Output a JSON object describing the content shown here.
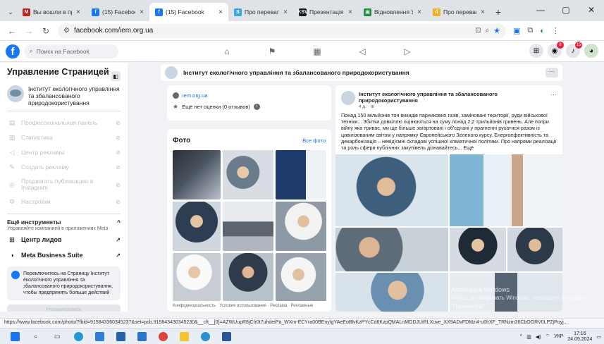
{
  "browser": {
    "tabs": [
      {
        "title": "Вы вошли в про",
        "active": false,
        "fav_color": "#c5221f",
        "fav_glyph": "M"
      },
      {
        "title": "(15) Facebook",
        "active": false,
        "fav_color": "#1877f2",
        "fav_glyph": "f"
      },
      {
        "title": "(15) Facebook",
        "active": true,
        "fav_color": "#1877f2",
        "fav_glyph": "f"
      },
      {
        "title": "Про переваги",
        "active": false,
        "fav_color": "#3aa7e0",
        "fav_glyph": "S"
      },
      {
        "title": "Презентація пр",
        "active": false,
        "fav_color": "#1a1a1a",
        "fav_glyph": "KSV"
      },
      {
        "title": "Відновлення Ук",
        "active": false,
        "fav_color": "#1e8e3e",
        "fav_glyph": "▣"
      },
      {
        "title": "Про переваги",
        "active": false,
        "fav_color": "#f2b01e",
        "fav_glyph": "d"
      }
    ],
    "url": "facebook.com/iem.org.ua",
    "window_controls": [
      "—",
      "▢",
      "✕"
    ]
  },
  "fb_nav": {
    "search_placeholder": "Поиск на Facebook",
    "badge_count": "15",
    "notif_badge": "8"
  },
  "sidebar": {
    "title": "Управление Страницей",
    "page_name": "Інститут екологічного управління та збалансованого природокористування",
    "items": [
      {
        "icon": "panel-icon",
        "glyph": "▤",
        "label": "Профессиональная панель"
      },
      {
        "icon": "stats-icon",
        "glyph": "▥",
        "label": "Статистика"
      },
      {
        "icon": "ads-icon",
        "glyph": "◁",
        "label": "Центр рекламы"
      },
      {
        "icon": "edit-icon",
        "glyph": "✎",
        "label": "Создать рекламу"
      },
      {
        "icon": "instagram-icon",
        "glyph": "◎",
        "label": "Продвигать публикацию в Instagram"
      },
      {
        "icon": "settings-icon",
        "glyph": "⚙",
        "label": "Настройки"
      }
    ],
    "more_tools": "Ещё инструменты",
    "more_tools_sub": "Управляйте компанией в приложениях Meta",
    "links": [
      {
        "icon": "leads-icon",
        "glyph": "⊞",
        "label": "Центр лидов"
      },
      {
        "icon": "meta-icon",
        "glyph": "◑",
        "label": "Meta Business Suite"
      }
    ],
    "switch_text": "Переключитесь на Страницу Інститут екологічного управління та збалансованого природокористування, чтобы предпринять больше действий",
    "cta_button": "Рекламировать"
  },
  "page_header": {
    "name": "Інститут екологічного управління та збалансованого природокористування",
    "more": "···"
  },
  "intro": {
    "website": "iem.org.ua",
    "rating": "Ещё нет оценки (0 отзывов)"
  },
  "photos": {
    "title": "Фото",
    "see_all": "Все фото",
    "footer": "Конфиденциальность · Условия использования · Реклама · Рекламные"
  },
  "post": {
    "author": "Інститут екологічного управління та збалансованого природокористування",
    "time": "4 д. · ⊕",
    "text": "Понад 150 мільйонів тон викидів парникових газів, заміновані території, руди військової техніки... Збитки довкіллю оцінюються на суму понад 2,2 трильйонів гривень. Але попри війну яка триває, ми ще більше загартовані і об'єднані у прагненні рухатися разом із цивілізованим світом у напрямку Європейського Зеленого курсу. Енергоефективність та декарбонізація – невід'ємні складові успішної кліматичної політики. Про напрями реалізації та роль сфери публічних закупівель дізнавайтесь... Ещё"
  },
  "watermark": {
    "line1": "Активация Windows",
    "line2": "Чтобы активировать Windows, перейдите в раздел \"Параметры\"."
  },
  "status_url": "https://www.facebook.com/photo/?fbid=915843360345237&set=pcb.915843430345230&__cft__[0]=AZWUupR8jCfr0t7uhdeiPa_WXm-ECYra00BEnyIgYAeEoBlvKzPYcCd6KzpQMALnMODJUiRLXuve_XX9ADvFDMzi4-u0lrXF_TRNzm3IICbOGRV0LPZjPoyj...",
  "taskbar": {
    "lang": "УКР",
    "time": "17:16",
    "date": "24.05.2024"
  },
  "colors": {
    "fb_blue": "#1877f2",
    "link": "#216fdb",
    "bg": "#f0f2f5"
  }
}
